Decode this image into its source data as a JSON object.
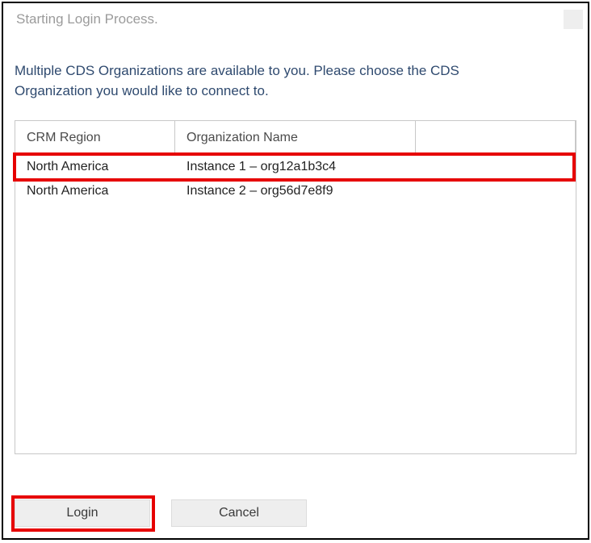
{
  "titlebar": {
    "title": "Starting Login Process."
  },
  "description": "Multiple CDS Organizations are available to you. Please choose the CDS Organization you would like to connect to.",
  "grid": {
    "headers": {
      "region": "CRM Region",
      "org": "Organization Name"
    },
    "rows": [
      {
        "region": "North America",
        "org": "Instance 1 – org12a1b3c4"
      },
      {
        "region": "North America",
        "org": "Instance 2 – org56d7e8f9"
      }
    ]
  },
  "buttons": {
    "login": "Login",
    "cancel": "Cancel"
  }
}
